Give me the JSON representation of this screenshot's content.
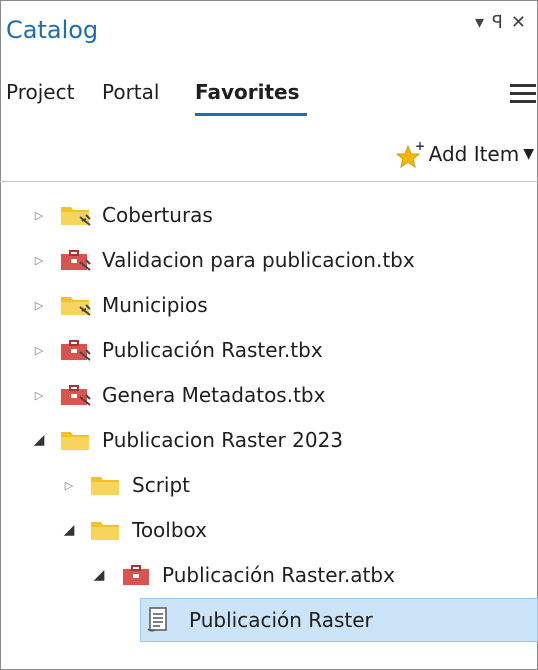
{
  "pane": {
    "title": "Catalog",
    "controls": "▾ ꟼ ✕"
  },
  "tabs": [
    {
      "label": "Project"
    },
    {
      "label": "Portal"
    },
    {
      "label": "Favorites"
    }
  ],
  "toolbar": {
    "add_item_label": "Add Item"
  },
  "tree": [
    {
      "label": "Coberturas"
    },
    {
      "label": "Validacion para publicacion.tbx"
    },
    {
      "label": "Municipios"
    },
    {
      "label": "Publicación Raster.tbx"
    },
    {
      "label": "Genera Metadatos.tbx"
    },
    {
      "label": "Publicacion Raster 2023"
    },
    {
      "label": "Script"
    },
    {
      "label": "Toolbox"
    },
    {
      "label": "Publicación Raster.atbx"
    },
    {
      "label": "Publicación Raster"
    }
  ],
  "colors": {
    "accent": "#1f6db0",
    "selection": "#cce4f7",
    "folder": "#f3c22b",
    "toolbox": "#d9534f"
  }
}
